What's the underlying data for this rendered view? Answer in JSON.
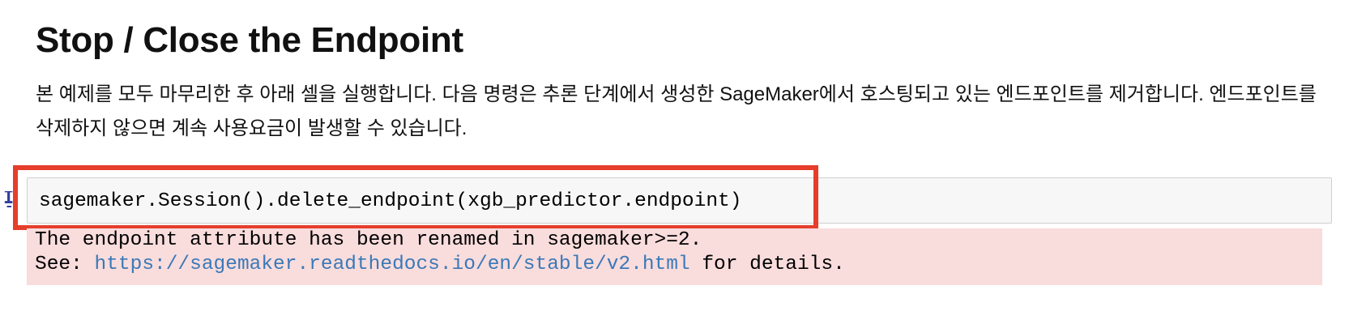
{
  "notebook": {
    "markdown_cell": {
      "heading": "Stop / Close the Endpoint",
      "description": "본 예제를 모두 마무리한 후 아래 셀을 실행합니다. 다음 명령은 추론 단계에서 생성한 SageMaker에서 호스팅되고 있는 엔드포인트를 제거합니다. 엔드포인트를 삭제하지 않으면 계속 사용요금이 발생할 수 있습니다."
    },
    "code_cell": {
      "prompt": "In [ ]:",
      "source": "sagemaker.Session().delete_endpoint(xgb_predictor.endpoint)"
    },
    "output": {
      "line1": "The endpoint attribute has been renamed in sagemaker>=2.",
      "line2_prefix": "See: ",
      "link_text": "https://sagemaker.readthedocs.io/en/stable/v2.html",
      "line2_suffix": " for details."
    },
    "colors": {
      "highlight_border": "#e53e2b",
      "error_background": "#f9dcdc",
      "link": "#3b79b8",
      "input_background": "#f7f7f7"
    }
  }
}
